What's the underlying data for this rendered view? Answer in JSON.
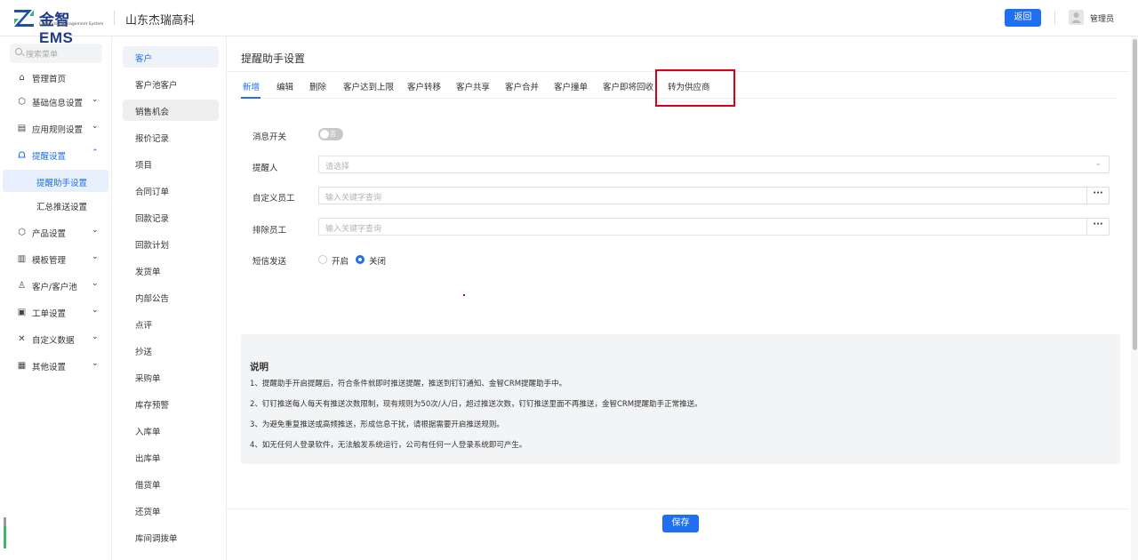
{
  "header": {
    "logo_title": "金智 EMS",
    "logo_subtitle": "Enterprise Management System",
    "company": "山东杰瑞高科",
    "back_button": "返回",
    "username": "管理员"
  },
  "sidebar": {
    "search_placeholder": "搜索菜单",
    "items": [
      {
        "label": "管理首页",
        "icon": "home-icon",
        "glyph": "⌂"
      },
      {
        "label": "基础信息设置",
        "icon": "cube-icon",
        "glyph": "⬡"
      },
      {
        "label": "应用规则设置",
        "icon": "document-icon",
        "glyph": "▤"
      },
      {
        "label": "提醒设置",
        "icon": "bell-icon",
        "glyph": "♫"
      },
      {
        "label": "产品设置",
        "icon": "box-icon",
        "glyph": "⬡"
      },
      {
        "label": "模板管理",
        "icon": "template-icon",
        "glyph": "▥"
      },
      {
        "label": "客户/客户池",
        "icon": "user-group-icon",
        "glyph": "♙"
      },
      {
        "label": "工单设置",
        "icon": "form-icon",
        "glyph": "▣"
      },
      {
        "label": "自定义数据",
        "icon": "tools-icon",
        "glyph": "✕"
      },
      {
        "label": "其他设置",
        "icon": "grid-icon",
        "glyph": "▦"
      }
    ],
    "sub_items": [
      "提醒助手设置",
      "汇总推送设置"
    ]
  },
  "col2": {
    "items": [
      "客户",
      "客户池客户",
      "销售机会",
      "报价记录",
      "项目",
      "合同订单",
      "回款记录",
      "回款计划",
      "发货单",
      "内部公告",
      "点评",
      "抄送",
      "采购单",
      "库存预警",
      "入库单",
      "出库单",
      "借货单",
      "还货单",
      "库间调拨单"
    ]
  },
  "main": {
    "title": "提醒助手设置",
    "tabs": [
      "新增",
      "编辑",
      "删除",
      "客户达到上限",
      "客户转移",
      "客户共享",
      "客户合并",
      "客户撞单",
      "客户即将回收",
      "转为供应商"
    ],
    "form": {
      "switch_label": "消息开关",
      "switch_state": "否",
      "reminder_label": "提醒人",
      "reminder_placeholder": "请选择",
      "custom_label": "自定义员工",
      "custom_placeholder": "输入关键字查询",
      "exclude_label": "排除员工",
      "exclude_placeholder": "输入关键字查询",
      "more_button": "···",
      "sms_label": "短信发送",
      "sms_on": "开启",
      "sms_off": "关闭"
    },
    "note": {
      "title": "说明",
      "lines": [
        "1、提醒助手开启提醒后，符合条件就即时推送提醒，推送到钉钉通知、金智CRM提醒助手中。",
        "2、钉钉推送每人每天有推送次数限制，现有规则为50次/人/日，超过推送次数，钉钉推送里面不再推送，金智CRM提醒助手正常推送。",
        "3、为避免重复推送或高频推送，形成信息干扰，请根据需要开启推送规则。",
        "4、如无任何人登录软件，无法触发系统运行，公司有任何一人登录系统即可产生。"
      ]
    },
    "save_button": "保存"
  },
  "colors": {
    "accent": "#1f6ff0",
    "highlight": "#d9001b"
  }
}
